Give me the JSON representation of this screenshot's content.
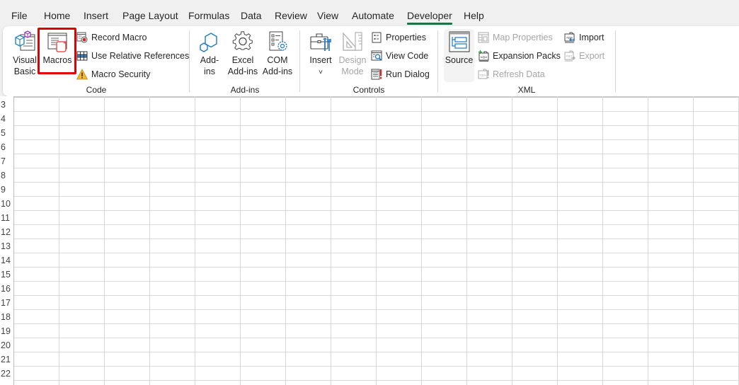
{
  "menu": {
    "tabs": [
      {
        "label": "File"
      },
      {
        "label": "Home"
      },
      {
        "label": "Insert"
      },
      {
        "label": "Page Layout"
      },
      {
        "label": "Formulas"
      },
      {
        "label": "Data"
      },
      {
        "label": "Review"
      },
      {
        "label": "View"
      },
      {
        "label": "Automate"
      },
      {
        "label": "Developer",
        "active": true
      },
      {
        "label": "Help"
      }
    ]
  },
  "ribbon": {
    "code": {
      "label": "Code",
      "visual_basic": {
        "line1": "Visual",
        "line2": "Basic"
      },
      "macros": {
        "label": "Macros",
        "highlighted": true
      },
      "record_macro": "Record Macro",
      "use_relative_references": "Use Relative References",
      "macro_security": "Macro Security"
    },
    "addins": {
      "label": "Add-ins",
      "addins": {
        "line1": "Add-",
        "line2": "ins"
      },
      "excel_addins": {
        "line1": "Excel",
        "line2": "Add-ins"
      },
      "com_addins": {
        "line1": "COM",
        "line2": "Add-ins"
      }
    },
    "controls": {
      "label": "Controls",
      "insert": {
        "line1": "Insert",
        "line2": "˅"
      },
      "design_mode": {
        "line1": "Design",
        "line2": "Mode",
        "disabled": true
      },
      "properties": "Properties",
      "view_code": "View Code",
      "run_dialog": "Run Dialog"
    },
    "xml": {
      "label": "XML",
      "source": "Source",
      "map_properties": "Map Properties",
      "expansion_packs": "Expansion Packs",
      "refresh_data": "Refresh Data",
      "import": "Import",
      "export": "Export"
    }
  },
  "sheet": {
    "rows": [
      "3",
      "4",
      "5",
      "6",
      "7",
      "8",
      "9",
      "10",
      "11",
      "12",
      "13",
      "14",
      "15",
      "16",
      "17",
      "18",
      "19",
      "20",
      "21",
      "22"
    ]
  },
  "colors": {
    "accent": "#1f7246",
    "highlight": "#e00000",
    "disabled_text": "#a6a6a6"
  }
}
